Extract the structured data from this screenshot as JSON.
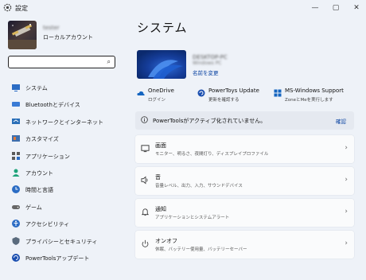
{
  "window": {
    "title": "設定",
    "controls": {
      "minimize": "—",
      "maximize": "▢",
      "close": "✕"
    }
  },
  "user": {
    "name": "tester",
    "account_type": "ローカルアカウント"
  },
  "search": {
    "placeholder": "",
    "icon": "search-icon"
  },
  "sidebar": {
    "items": [
      {
        "label": "システム",
        "icon": "display-icon"
      },
      {
        "label": "Bluetoothとデバイス",
        "icon": "bluetooth-icon"
      },
      {
        "label": "ネットワークとインターネット",
        "icon": "network-icon"
      },
      {
        "label": "カスタマイズ",
        "icon": "brush-icon"
      },
      {
        "label": "アプリケーション",
        "icon": "apps-icon"
      },
      {
        "label": "アカウント",
        "icon": "person-icon"
      },
      {
        "label": "時間と言語",
        "icon": "globe-clock-icon"
      },
      {
        "label": "ゲーム",
        "icon": "gamepad-icon"
      },
      {
        "label": "アクセシビリティ",
        "icon": "accessibility-icon"
      },
      {
        "label": "プライバシーとセキュリティ",
        "icon": "shield-icon"
      },
      {
        "label": "PowerToolsアップデート",
        "icon": "update-icon"
      }
    ]
  },
  "main": {
    "title": "システム",
    "device": {
      "name": "DESKTOP-PC",
      "model": "Windows PC",
      "rename": "名前を変更"
    },
    "quick": [
      {
        "title": "OneDrive",
        "subtitle": "ログイン",
        "icon": "cloud-icon"
      },
      {
        "title": "PowerToys Update",
        "subtitle": "更新を確認する",
        "icon": "sync-icon"
      },
      {
        "title": "MS-Windows Support",
        "subtitle": "ZoneとMeを実行します",
        "icon": "windows-icon"
      }
    ],
    "banner": {
      "text": "PowerToolsがアクティブ化されていません。",
      "action": "確認"
    },
    "cards": [
      {
        "title": "画面",
        "subtitle": "モニター、明るさ、夜間灯り、ディスプレイプロファイル",
        "icon": "display-icon"
      },
      {
        "title": "音",
        "subtitle": "音量レベル、出力、入力、サウンドデバイス",
        "icon": "speaker-icon"
      },
      {
        "title": "通知",
        "subtitle": "アプリケーションとシステムアラート",
        "icon": "bell-icon"
      },
      {
        "title": "オンオフ",
        "subtitle": "休眠、バッテリー使用量、バッテリーセーバー",
        "icon": "power-icon"
      }
    ],
    "chevron": "›"
  },
  "colors": {
    "background": "#eef2f8",
    "accent": "#0067c0",
    "link": "#003c9e"
  }
}
